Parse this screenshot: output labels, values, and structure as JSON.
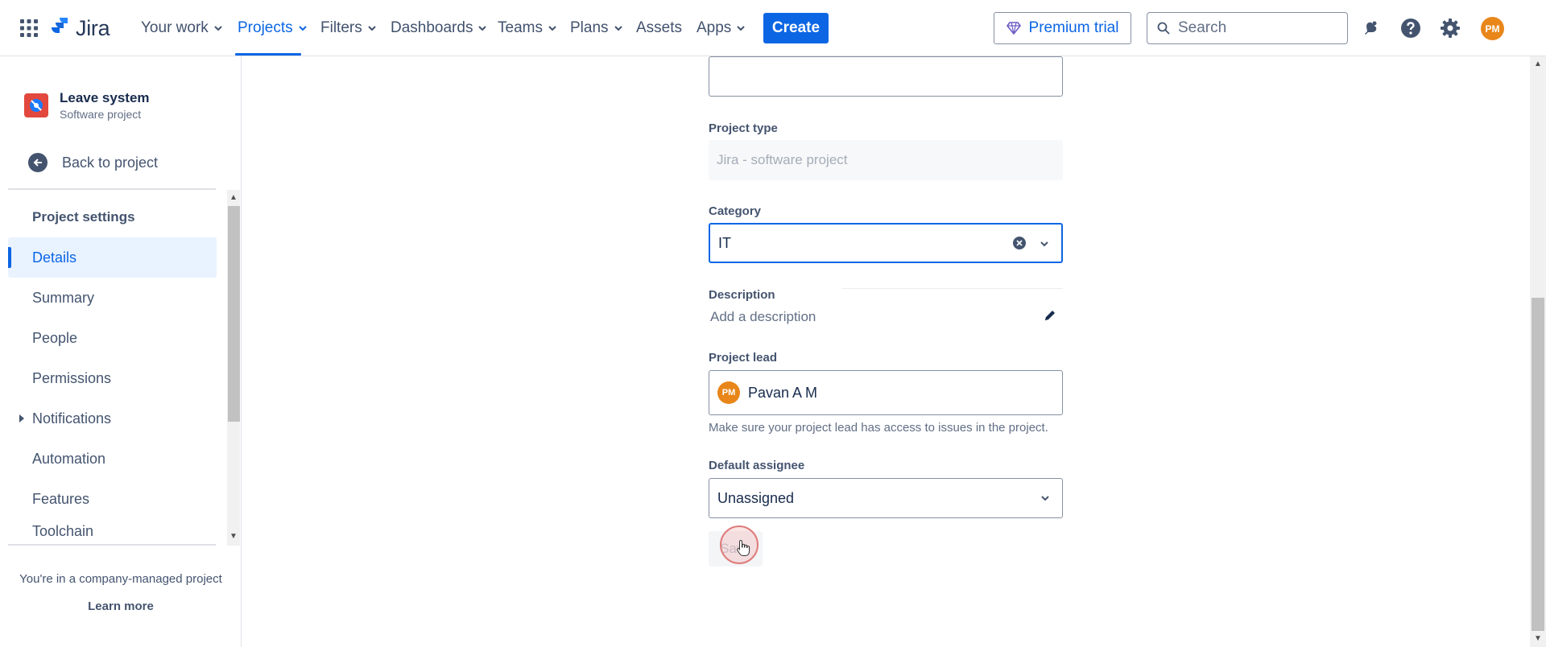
{
  "topnav": {
    "logo_text": "Jira",
    "items": [
      {
        "label": "Your work",
        "has_chevron": true
      },
      {
        "label": "Projects",
        "has_chevron": true,
        "active": true
      },
      {
        "label": "Filters",
        "has_chevron": true
      },
      {
        "label": "Dashboards",
        "has_chevron": true
      },
      {
        "label": "Teams",
        "has_chevron": true
      },
      {
        "label": "Plans",
        "has_chevron": true
      },
      {
        "label": "Assets",
        "has_chevron": false
      },
      {
        "label": "Apps",
        "has_chevron": true
      }
    ],
    "create_label": "Create",
    "premium_label": "Premium trial",
    "search_placeholder": "Search",
    "avatar_initials": "PM"
  },
  "sidebar": {
    "project_name": "Leave system",
    "project_type": "Software project",
    "back_label": "Back to project",
    "settings_title": "Project settings",
    "items": [
      {
        "label": "Details",
        "active": true
      },
      {
        "label": "Summary"
      },
      {
        "label": "People"
      },
      {
        "label": "Permissions"
      },
      {
        "label": "Notifications",
        "expandable": true
      },
      {
        "label": "Automation"
      },
      {
        "label": "Features"
      },
      {
        "label": "Toolchain"
      }
    ],
    "company_note": "You're in a company-managed project",
    "learn_more": "Learn more"
  },
  "form": {
    "project_type_label": "Project type",
    "project_type_value": "Jira - software project",
    "category_label": "Category",
    "category_value": "IT",
    "description_label": "Description",
    "description_placeholder": "Add a description",
    "lead_label": "Project lead",
    "lead_initials": "PM",
    "lead_name": "Pavan A M",
    "lead_helper": "Make sure your project lead has access to issues in the project.",
    "assignee_label": "Default assignee",
    "assignee_value": "Unassigned",
    "save_label": "Save"
  },
  "colors": {
    "brand_blue": "#0c66e4",
    "avatar_orange": "#e8861a",
    "project_icon_red": "#e2483d"
  }
}
